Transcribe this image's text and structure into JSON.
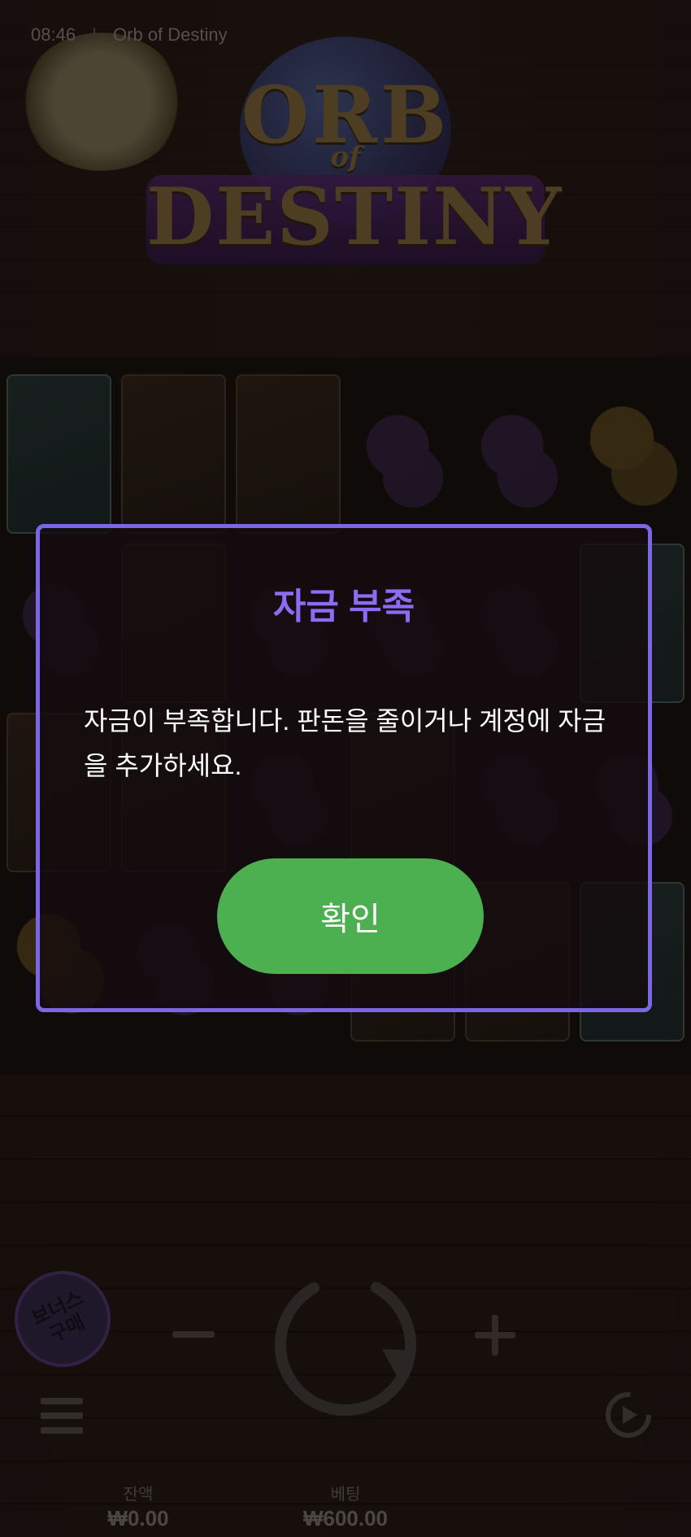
{
  "status": {
    "time": "08:46",
    "separator": "|",
    "game_name": "Orb of Destiny"
  },
  "logo": {
    "line1": "ORB",
    "line2": "of",
    "line3": "DESTINY"
  },
  "dialog": {
    "title": "자금 부족",
    "message": "자금이 부족합니다. 판돈을 줄이거나 계정에 자금을 추가하세요.",
    "confirm_label": "확인",
    "accent_color": "#7b66e6",
    "button_color": "#4caf50"
  },
  "controls": {
    "bonus_buy_label": "보너스 구매",
    "spin_icon": "refresh-icon",
    "menu_icon": "hamburger-menu-icon",
    "autoplay_icon": "autoplay-icon"
  },
  "footer": {
    "balance_label": "잔액",
    "balance_value": "₩0.00",
    "bet_label": "베팅",
    "bet_value": "₩600.00"
  }
}
